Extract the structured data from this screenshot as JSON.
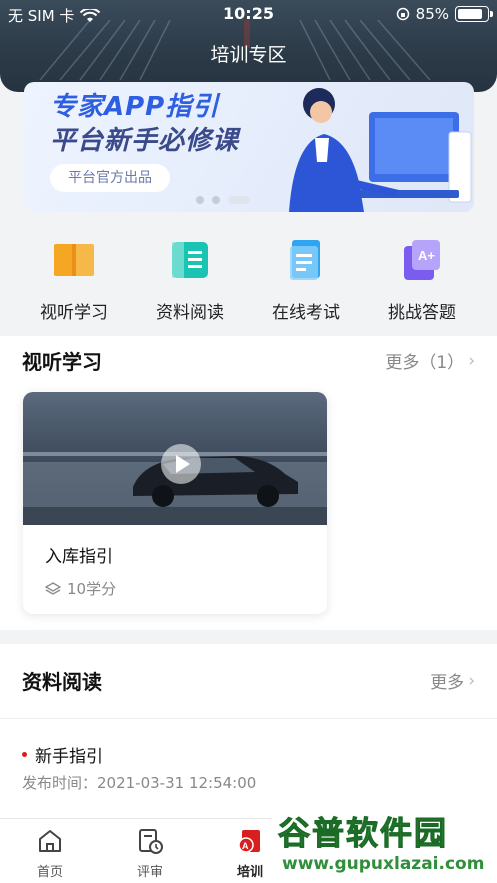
{
  "status_bar": {
    "carrier": "无 SIM 卡",
    "time": "10:25",
    "battery": "85%",
    "battery_level": 0.85
  },
  "header": {
    "title": "培训专区"
  },
  "banner": {
    "line1": "专家APP指引",
    "line2": "平台新手必修课",
    "pill": "平台官方出品",
    "slides": 3,
    "active_slide": 3
  },
  "quick_menu": [
    {
      "label": "视听学习",
      "icon": "book-icon",
      "color": "#f5a623"
    },
    {
      "label": "资料阅读",
      "icon": "document-list-icon",
      "color": "#19c4b2"
    },
    {
      "label": "在线考试",
      "icon": "exam-paper-icon",
      "color": "#2fa5f0"
    },
    {
      "label": "挑战答题",
      "icon": "challenge-icon",
      "color": "#7b5cf0"
    }
  ],
  "av_section": {
    "title": "视听学习",
    "more": "更多（1）",
    "video": {
      "title": "入库指引",
      "credit": "10学分"
    }
  },
  "reading_section": {
    "title": "资料阅读",
    "more": "更多",
    "items": [
      {
        "title": "新手指引",
        "time": "发布时间：2021-03-31 12:54:00"
      }
    ]
  },
  "tabbar": [
    {
      "label": "首页",
      "icon": "home-icon",
      "active": false
    },
    {
      "label": "评审",
      "icon": "review-icon",
      "active": false
    },
    {
      "label": "培训",
      "icon": "training-icon",
      "active": true
    }
  ],
  "watermark": {
    "main": "谷普软件园",
    "sub": "www.gupuxlazai.com"
  },
  "colors": {
    "accent_red": "#d81e1e",
    "header_bg": "#2c3a47"
  }
}
